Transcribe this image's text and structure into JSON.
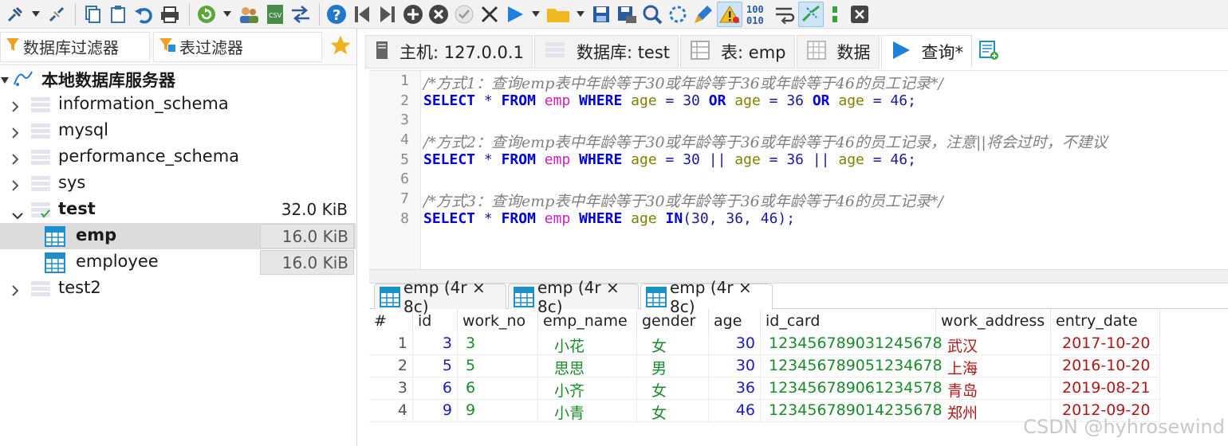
{
  "toolbar": {
    "icons": [
      "connect-icon",
      "dropdown-arrow-icon",
      "disconnect-icon",
      "copy-icon",
      "paste-icon",
      "undo-icon",
      "print-icon",
      "refresh-icon",
      "dropdown-arrow-icon",
      "user-manager-icon",
      "csv-icon",
      "sync-icon",
      "help-icon",
      "first-icon",
      "last-icon",
      "add-icon",
      "remove-icon",
      "check-icon",
      "cancel-icon",
      "execute-icon",
      "dropdown-arrow-icon",
      "folder-icon",
      "dropdown-arrow-icon",
      "save-icon",
      "save-as-icon",
      "search-icon",
      "refresh-query-icon",
      "clear-icon",
      "warning-icon",
      "binary-icon",
      "word-wrap-icon",
      "link-icon",
      "format-icon",
      "close-icon"
    ],
    "binary_label": "100\n010"
  },
  "left": {
    "db_filter": "数据库过滤器",
    "table_filter": "表过滤器",
    "root_label": "本地数据库服务器",
    "databases": [
      {
        "name": "information_schema"
      },
      {
        "name": "mysql"
      },
      {
        "name": "performance_schema"
      },
      {
        "name": "sys"
      },
      {
        "name": "test",
        "size": "32.0 KiB"
      },
      {
        "name": "test2"
      }
    ],
    "tables": [
      {
        "name": "emp",
        "size": "16.0 KiB"
      },
      {
        "name": "employee",
        "size": "16.0 KiB"
      }
    ]
  },
  "tabs": [
    {
      "label": "主机: 127.0.0.1"
    },
    {
      "label": "数据库: test"
    },
    {
      "label": "表: emp"
    },
    {
      "label": "数据"
    },
    {
      "label": "查询*"
    }
  ],
  "editor": {
    "line_numbers": [
      "1",
      "2",
      "3",
      "4",
      "5",
      "6",
      "7",
      "8"
    ],
    "comment1": "/*方式1：查询emp表中年龄等于30或年龄等于36或年龄等于46的员工记录*/",
    "comment2": "/*方式2：查询emp表中年龄等于30或年龄等于36或年龄等于46的员工记录，注意||将会过时，不建议",
    "comment3": "/*方式3：查询emp表中年龄等于30或年龄等于36或年龄等于46的员工记录*/",
    "kw_select": "SELECT",
    "star": "*",
    "kw_from": "FROM",
    "table": "emp",
    "kw_where": "WHERE",
    "col": "age",
    "eq": "=",
    "kw_or": "OR",
    "pipe": "||",
    "kw_in": "IN",
    "v30": "30",
    "v36": "36",
    "v46": "46",
    "semi": ";",
    "in_args": "(30, 36, 46);"
  },
  "result_tabs": [
    {
      "label": "emp (4r × 8c)"
    },
    {
      "label": "emp (4r × 8c)"
    },
    {
      "label": "emp (4r × 8c)"
    }
  ],
  "grid": {
    "headers": [
      "#",
      "id",
      "work_no",
      "emp_name",
      "gender",
      "age",
      "id_card",
      "work_address",
      "entry_date"
    ],
    "rows": [
      [
        "1",
        "3",
        "3",
        "小花",
        "女",
        "30",
        "123456789031245678",
        "武汉",
        "2017-10-20"
      ],
      [
        "2",
        "5",
        "5",
        "思思",
        "男",
        "30",
        "123456789051234678",
        "上海",
        "2016-10-20"
      ],
      [
        "3",
        "6",
        "6",
        "小齐",
        "女",
        "36",
        "123456789061234578",
        "青岛",
        "2019-08-21"
      ],
      [
        "4",
        "9",
        "9",
        "小青",
        "女",
        "46",
        "123456789014235678",
        "郑州",
        "2012-09-20"
      ]
    ]
  },
  "watermark": "CSDN @hyhrosewind",
  "colors": {
    "keyword": "#0000e0",
    "table": "#d020c0",
    "column": "#808000",
    "number": "#1a1aa0",
    "comment": "#808080",
    "green": "#1a8a2a",
    "red": "#b01818",
    "blue_num": "#1a1ac0"
  }
}
